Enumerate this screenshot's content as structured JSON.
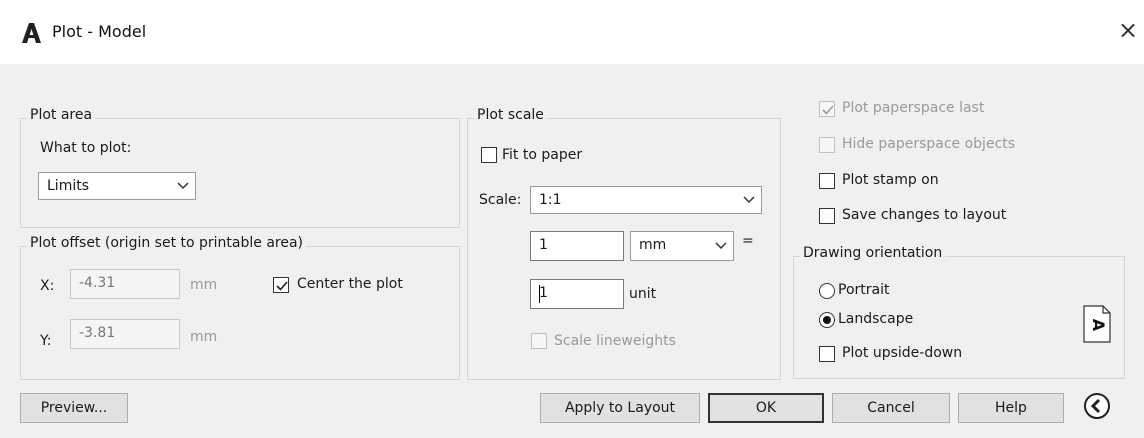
{
  "window": {
    "title": "Plot - Model",
    "logo_icon": "autocad-a-icon",
    "close_glyph": "×"
  },
  "plot_area": {
    "legend": "Plot area",
    "what_to_plot_label": "What to plot:",
    "what_to_plot_value": "Limits"
  },
  "plot_offset": {
    "legend": "Plot offset (origin set to printable area)",
    "x_label": "X:",
    "x_value": "-4.31",
    "x_unit": "mm",
    "y_label": "Y:",
    "y_value": "-3.81",
    "y_unit": "mm",
    "center_label": "Center the plot",
    "center_checked": true
  },
  "plot_scale": {
    "legend": "Plot scale",
    "fit_label": "Fit to paper",
    "fit_checked": false,
    "scale_label": "Scale:",
    "scale_value": "1:1",
    "value1": "1",
    "unit1": "mm",
    "equals": "=",
    "value2": "1",
    "unit2": "unit",
    "lineweights_label": "Scale lineweights",
    "lineweights_checked": false
  },
  "options": {
    "paperspace_last_label": "Plot paperspace last",
    "paperspace_last_checked": true,
    "hide_paperspace_label": "Hide paperspace objects",
    "hide_paperspace_checked": false,
    "plot_stamp_label": "Plot stamp on",
    "plot_stamp_checked": false,
    "save_changes_label": "Save changes to layout",
    "save_changes_checked": false
  },
  "orientation": {
    "legend": "Drawing orientation",
    "portrait_label": "Portrait",
    "landscape_label": "Landscape",
    "selected": "Landscape",
    "upside_down_label": "Plot upside-down",
    "upside_down_checked": false,
    "preview_glyph": "A"
  },
  "buttons": {
    "preview": "Preview...",
    "apply": "Apply to Layout",
    "ok": "OK",
    "cancel": "Cancel",
    "help": "Help"
  },
  "colors": {
    "dialog_bg": "#f0f0f0",
    "border": "#d5d5d5",
    "disabled_text": "#9a9a9a"
  }
}
